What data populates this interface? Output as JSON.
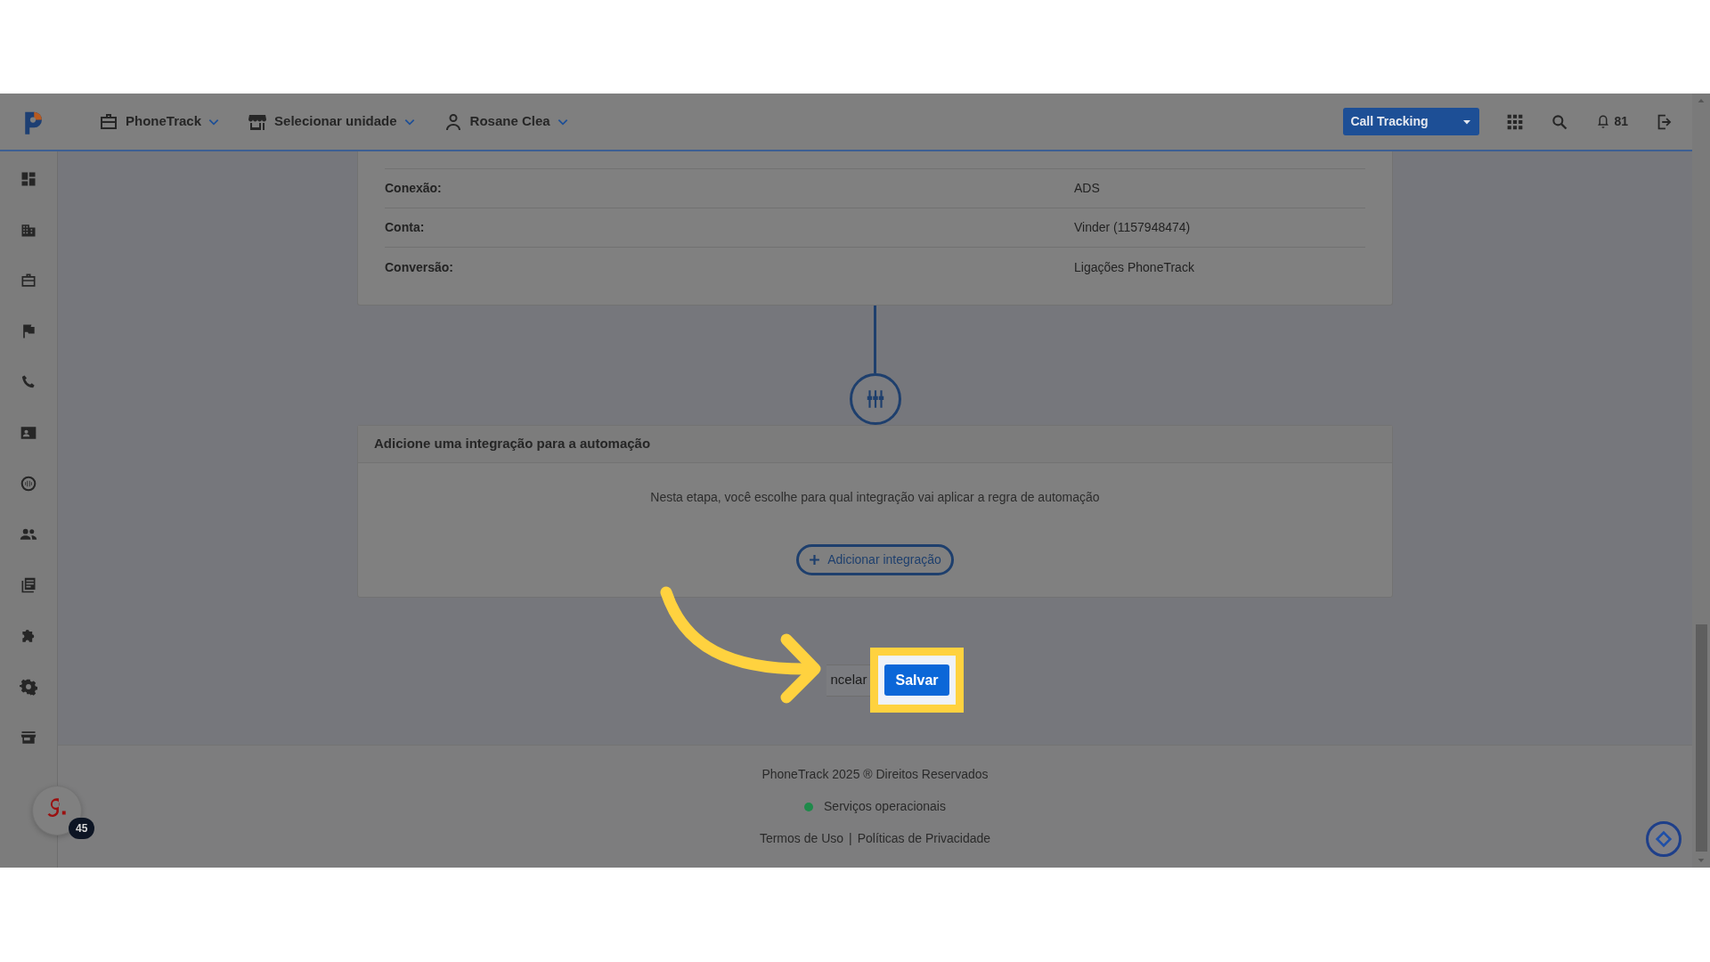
{
  "topbar": {
    "menus": [
      {
        "label": "PhoneTrack"
      },
      {
        "label": "Selecionar unidade"
      },
      {
        "label": "Rosane Clea"
      }
    ],
    "product_select": {
      "value": "Call Tracking"
    },
    "notifications": "81"
  },
  "details": {
    "rows": [
      {
        "label": "Conexão:",
        "value": "ADS"
      },
      {
        "label": "Conta:",
        "value": "Vinder (1157948474)"
      },
      {
        "label": "Conversão:",
        "value": "Ligações PhoneTrack"
      }
    ]
  },
  "integration_card": {
    "title": "Adicione uma integração para a automação",
    "text": "Nesta etapa, você escolhe para qual integração vai aplicar a regra de automação",
    "add_button": "Adicionar integração"
  },
  "actions": {
    "cancel": "ncelar",
    "save": "Salvar"
  },
  "footer": {
    "copyright": "PhoneTrack 2025 ® Direitos Reservados",
    "status": "Serviços operacionais",
    "links": [
      "Termos de Uso",
      "Políticas de Privacidade"
    ],
    "separator": "|"
  },
  "chat_badge": "45"
}
